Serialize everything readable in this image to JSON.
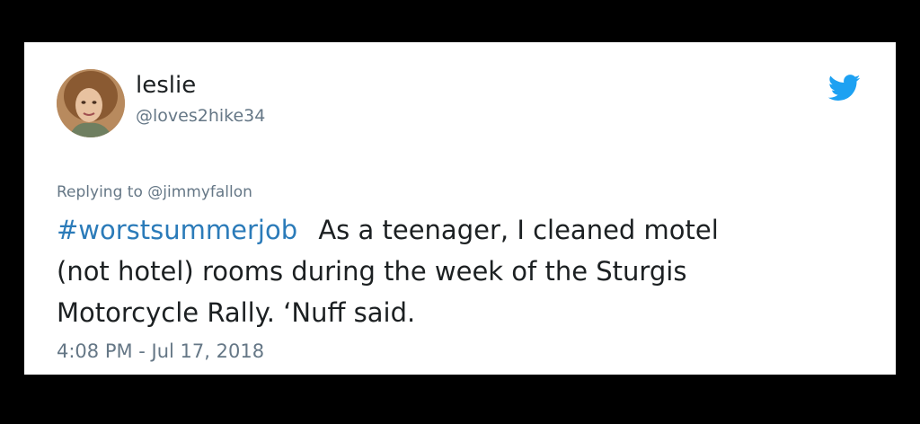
{
  "user": {
    "display_name": "leslie",
    "handle": "@loves2hike34"
  },
  "reply": {
    "prefix": "Replying to",
    "mention": "@jimmyfallon"
  },
  "tweet": {
    "hashtag": "#worstsummerjob",
    "line1": "As a teenager, I cleaned motel",
    "line2": "(not hotel) rooms during the week of the Sturgis",
    "line3": "Motorcycle Rally. ‘Nuff said."
  },
  "timestamp": "4:08 PM - Jul 17, 2018",
  "icons": {
    "brand": "twitter-bird-icon",
    "avatar": "profile-photo"
  },
  "colors": {
    "twitter_blue": "#1da1f2",
    "hashtag": "#2b7bb9",
    "muted_text": "#657786",
    "primary_text": "#1c2022"
  }
}
